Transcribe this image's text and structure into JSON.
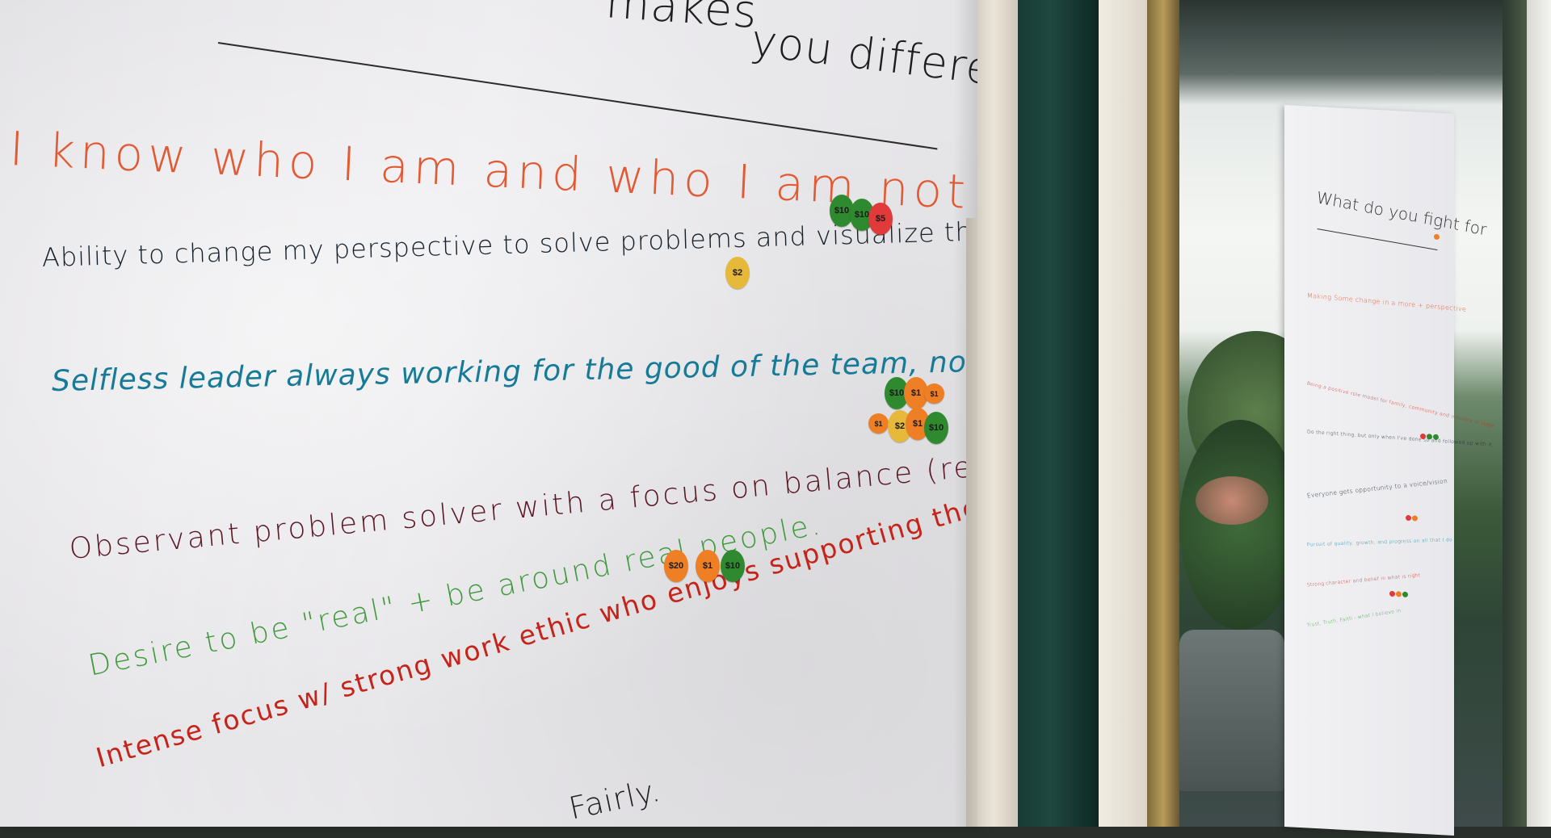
{
  "main_poster": {
    "title_partial": "makes",
    "title_rest": "you different",
    "statements": [
      {
        "text": "I know who I am and who I am not",
        "color": "#e25a34"
      },
      {
        "text": "Ability to change my perspective to solve problems and visualize the solution",
        "color": "#15202a"
      },
      {
        "text": "Selfless leader always working for the good of the team, not myself.",
        "color": "#177a96"
      },
      {
        "text": "Observant problem solver with a focus on balance (relaxed alertness)",
        "color": "#5a1624"
      },
      {
        "text": "Desire to be \"real\" + be around real people.",
        "color": "#3f9a3c"
      },
      {
        "text": "Intense focus w/ strong work ethic who enjoys supporting the entreprenurial effort",
        "color": "#c5241b"
      },
      {
        "text": "Fairly.",
        "color": "#1e1e1e"
      }
    ],
    "stickers": [
      {
        "group": "I know who I am",
        "label": "$10",
        "color": "#2f8a2f"
      },
      {
        "group": "I know who I am",
        "label": "$10",
        "color": "#2f8a2f"
      },
      {
        "group": "I know who I am",
        "label": "$5",
        "color": "#e03a3a"
      },
      {
        "group": "Ability",
        "label": "$2",
        "color": "#e6b93a"
      },
      {
        "group": "Selfless",
        "label": "$10",
        "color": "#2f8a2f"
      },
      {
        "group": "Selfless",
        "label": "$1",
        "color": "#ef7f24"
      },
      {
        "group": "Selfless",
        "label": "$1",
        "color": "#ef7f24"
      },
      {
        "group": "Selfless",
        "label": "$1",
        "color": "#ef7f24"
      },
      {
        "group": "Selfless",
        "label": "$2",
        "color": "#e6b93a"
      },
      {
        "group": "Selfless",
        "label": "$1",
        "color": "#ef7f24"
      },
      {
        "group": "Selfless",
        "label": "$10",
        "color": "#2f8a2f"
      },
      {
        "group": "Desire",
        "label": "$20",
        "color": "#ef7f24"
      },
      {
        "group": "Desire",
        "label": "$1",
        "color": "#ef7f24"
      },
      {
        "group": "Desire",
        "label": "$10",
        "color": "#2f8a2f"
      }
    ]
  },
  "second_poster": {
    "title": "What do you fight for",
    "lines": [
      {
        "text": "Making Some change in a more + perspective",
        "color": "#e25a34"
      },
      {
        "text": "Being a positive role model for family, community and industry at large",
        "color": "#c5241b"
      },
      {
        "text": "Do the right thing, but only when I've done so and followed up with it",
        "color": "#15202a"
      },
      {
        "text": "Everyone gets opportunity to a voice/vision",
        "color": "#15202a"
      },
      {
        "text": "Pursuit of quality, growth, and progress on all that I do",
        "color": "#177a96"
      },
      {
        "text": "Strong character and belief in what is right",
        "color": "#c5241b"
      },
      {
        "text": "Trust, Truth, Faith - what I believe in",
        "color": "#3f9a3c"
      }
    ]
  }
}
